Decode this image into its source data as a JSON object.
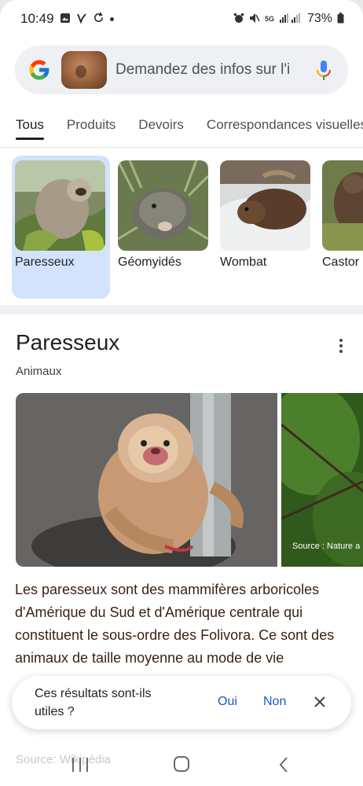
{
  "status_bar": {
    "time": "10:49",
    "battery": "73%",
    "network": "5G"
  },
  "search": {
    "query_placeholder": "Demandez des infos sur l'i",
    "mic_icon": "mic-icon",
    "logo_icon": "google-g-logo"
  },
  "tabs": [
    {
      "label": "Tous",
      "active": true
    },
    {
      "label": "Produits",
      "active": false
    },
    {
      "label": "Devoirs",
      "active": false
    },
    {
      "label": "Correspondances visuelles",
      "active": false
    }
  ],
  "related": [
    {
      "label": "Paresseux",
      "selected": true
    },
    {
      "label": "Géomyidés",
      "selected": false
    },
    {
      "label": "Wombat",
      "selected": false
    },
    {
      "label": "Castor",
      "selected": false
    }
  ],
  "knowledge_panel": {
    "title": "Paresseux",
    "subtitle": "Animaux",
    "image_source": "Source : Nature a",
    "description": "Les paresseux sont des mammifères arboricoles d'Amérique du Sud et d'Amérique centrale qui constituent le sous-ordre des Folivora. Ce sont des animaux de taille moyenne au mode de vie",
    "source": "Source: Wikipédia"
  },
  "feedback": {
    "question": "Ces résultats sont-ils utiles ?",
    "yes": "Oui",
    "no": "Non"
  },
  "colors": {
    "accent_blue": "#1a57c9",
    "selected_card": "#d3e3fd",
    "description_text": "#3a1f14"
  }
}
